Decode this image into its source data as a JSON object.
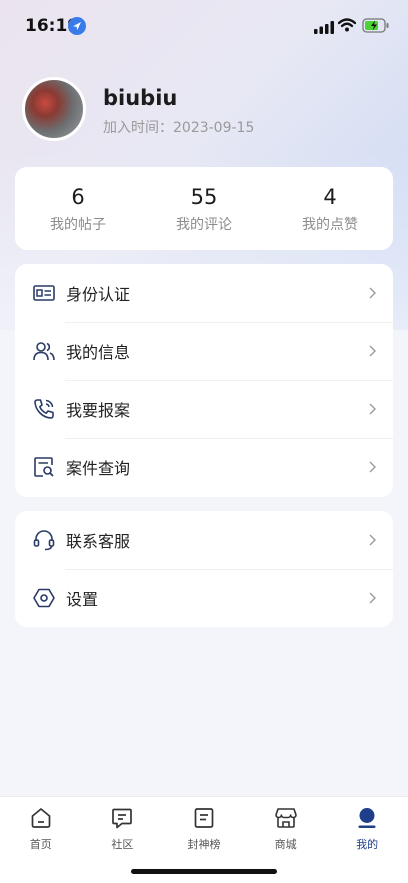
{
  "status_bar": {
    "time": "16:19"
  },
  "profile": {
    "username": "biubiu",
    "join_date": "加入时间：2023-09-15"
  },
  "stats": [
    {
      "value": "6",
      "label": "我的帖子"
    },
    {
      "value": "55",
      "label": "我的评论"
    },
    {
      "value": "4",
      "label": "我的点赞"
    }
  ],
  "menu_group_1": [
    {
      "label": "身份认证",
      "icon": "id-card-icon"
    },
    {
      "label": "我的信息",
      "icon": "users-icon"
    },
    {
      "label": "我要报案",
      "icon": "phone-call-icon"
    },
    {
      "label": "案件查询",
      "icon": "case-search-icon"
    }
  ],
  "menu_group_2": [
    {
      "label": "联系客服",
      "icon": "headset-icon"
    },
    {
      "label": "设置",
      "icon": "settings-hexagon-icon"
    }
  ],
  "tabs": [
    {
      "label": "首页",
      "icon": "home-icon"
    },
    {
      "label": "社区",
      "icon": "chat-icon"
    },
    {
      "label": "封神榜",
      "icon": "ranking-icon"
    },
    {
      "label": "商城",
      "icon": "shop-icon"
    },
    {
      "label": "我的",
      "icon": "profile-icon",
      "active": true
    }
  ],
  "colors": {
    "accent": "#1f3f8a",
    "icon_stroke": "#2a3a66",
    "background": "#f4f5fa"
  }
}
